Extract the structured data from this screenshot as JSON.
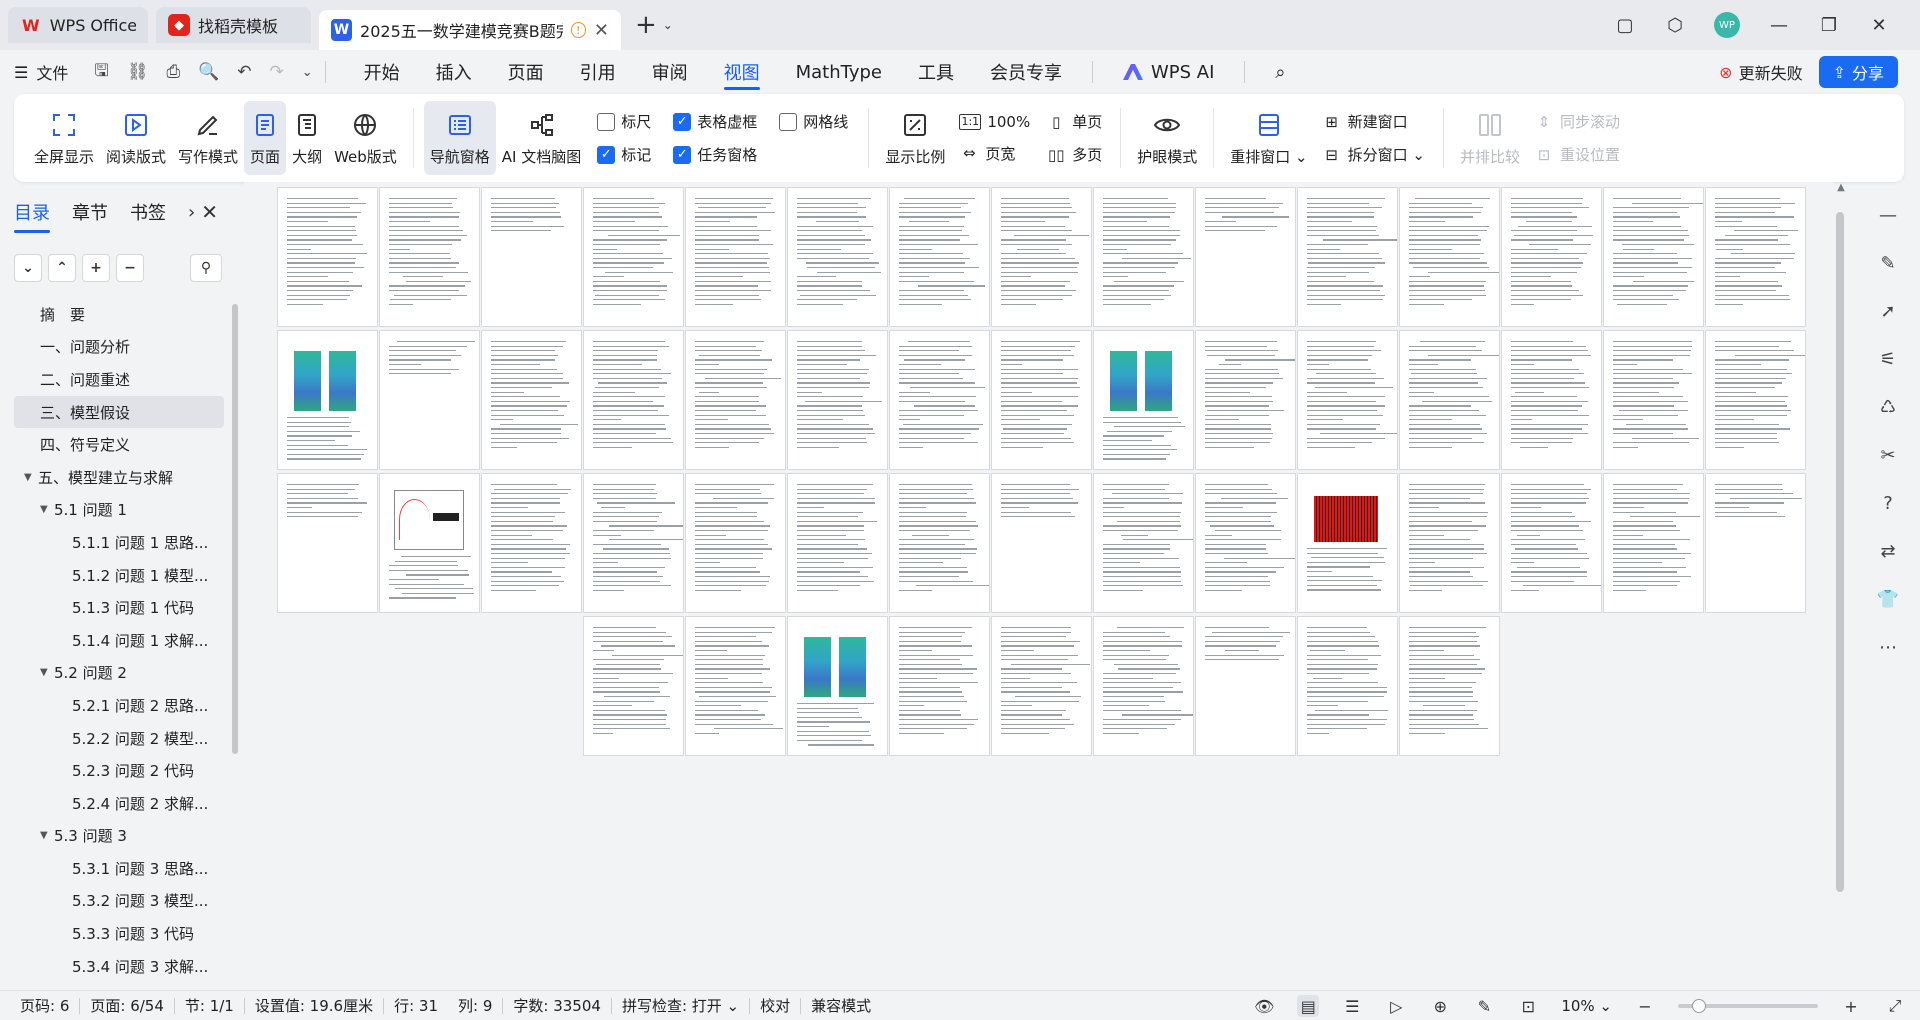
{
  "tabs": [
    {
      "label": "WPS Office"
    },
    {
      "label": "找稻壳模板"
    },
    {
      "label": "2025五一数学建模竞赛B题完"
    }
  ],
  "window_controls": {
    "avatar": "WP"
  },
  "menubar": {
    "file": "文件",
    "items": [
      "开始",
      "插入",
      "页面",
      "引用",
      "审阅",
      "视图",
      "MathType",
      "工具",
      "会员专享"
    ],
    "active": "视图",
    "wps_ai": "WPS AI",
    "update_fail": "更新失败",
    "share": "分享"
  },
  "ribbon": {
    "fullscreen": "全屏显示",
    "reading": "阅读版式",
    "writing": "写作模式",
    "page": "页面",
    "outline": "大纲",
    "web": "Web版式",
    "nav_pane": "导航窗格",
    "ai_map": "AI 文档脑图",
    "checks": [
      {
        "label": "标尺",
        "checked": false
      },
      {
        "label": "表格虚框",
        "checked": true
      },
      {
        "label": "网格线",
        "checked": false
      },
      {
        "label": "标记",
        "checked": true
      },
      {
        "label": "任务窗格",
        "checked": true
      }
    ],
    "zoom_ratio": "显示比例",
    "zoom_100": "100%",
    "page_width": "页宽",
    "single_page": "单页",
    "multi_page": "多页",
    "eye_mode": "护眼模式",
    "rearrange": "重排窗口",
    "new_window": "新建窗口",
    "split_window": "拆分窗口",
    "side_by_side": "并排比较",
    "sync_scroll": "同步滚动",
    "reset_pos": "重设位置"
  },
  "nav": {
    "tabs": [
      "目录",
      "章节",
      "书签"
    ],
    "toc": [
      {
        "label": "摘　要",
        "level": 0,
        "caret": ""
      },
      {
        "label": "一、问题分析",
        "level": 0,
        "caret": ""
      },
      {
        "label": "二、问题重述",
        "level": 0,
        "caret": ""
      },
      {
        "label": "三、模型假设",
        "level": 0,
        "caret": "",
        "selected": true
      },
      {
        "label": "四、符号定义",
        "level": 0,
        "caret": ""
      },
      {
        "label": "五、模型建立与求解",
        "level": 0,
        "caret": "▼"
      },
      {
        "label": "5.1 问题 1",
        "level": 1,
        "caret": "▼"
      },
      {
        "label": "5.1.1 问题 1 思路...",
        "level": 2,
        "caret": ""
      },
      {
        "label": "5.1.2 问题 1 模型...",
        "level": 2,
        "caret": ""
      },
      {
        "label": "5.1.3 问题 1 代码",
        "level": 2,
        "caret": ""
      },
      {
        "label": "5.1.4 问题 1 求解...",
        "level": 2,
        "caret": ""
      },
      {
        "label": "5.2 问题 2",
        "level": 1,
        "caret": "▼"
      },
      {
        "label": "5.2.1 问题 2 思路...",
        "level": 2,
        "caret": ""
      },
      {
        "label": "5.2.2 问题 2 模型...",
        "level": 2,
        "caret": ""
      },
      {
        "label": "5.2.3 问题 2 代码",
        "level": 2,
        "caret": ""
      },
      {
        "label": "5.2.4 问题 2 求解...",
        "level": 2,
        "caret": ""
      },
      {
        "label": "5.3 问题 3",
        "level": 1,
        "caret": "▼"
      },
      {
        "label": "5.3.1 问题 3 思路...",
        "level": 2,
        "caret": ""
      },
      {
        "label": "5.3.2 问题 3 模型...",
        "level": 2,
        "caret": ""
      },
      {
        "label": "5.3.3 问题 3 代码",
        "level": 2,
        "caret": ""
      },
      {
        "label": "5.3.4 问题 3 求解...",
        "level": 2,
        "caret": ""
      }
    ]
  },
  "pages": {
    "total": 54
  },
  "status": {
    "page_no": "页码: 6",
    "page": "页面: 6/54",
    "section": "节: 1/1",
    "setting": "设置值: 19.6厘米",
    "row": "行: 31",
    "col": "列: 9",
    "words": "字数: 33504",
    "spell": "拼写检查: 打开",
    "proof": "校对",
    "compat": "兼容模式",
    "zoom": "10%",
    "zoom_level": 0.1
  }
}
